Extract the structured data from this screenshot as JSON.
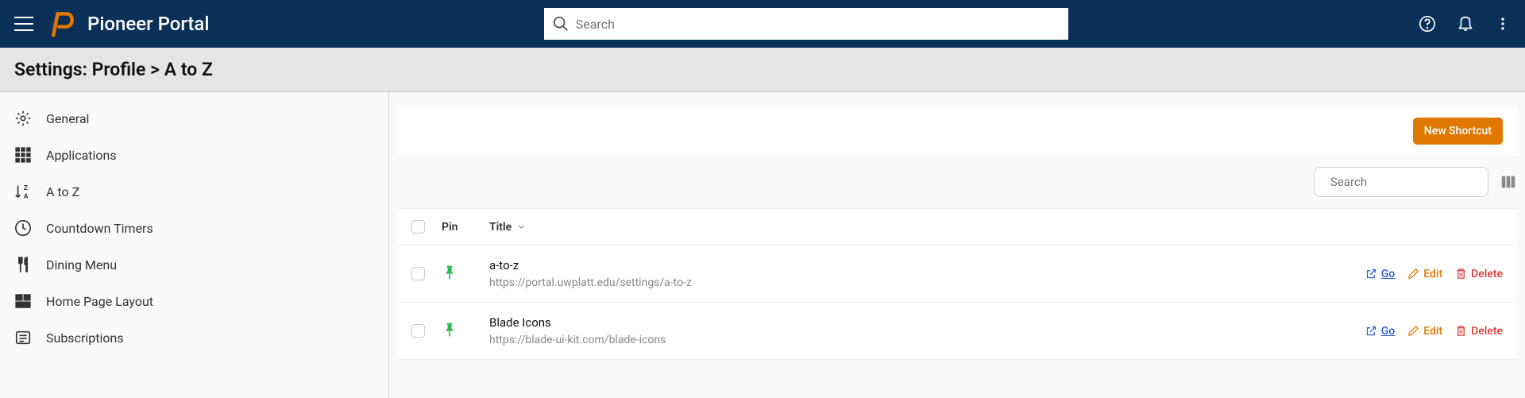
{
  "app": {
    "title": "Pioneer Portal",
    "search_placeholder": "Search"
  },
  "page": {
    "heading": "Settings: Profile > A to Z"
  },
  "sidebar": {
    "items": [
      {
        "label": "General",
        "icon": "gear"
      },
      {
        "label": "Applications",
        "icon": "grid"
      },
      {
        "label": "A to Z",
        "icon": "sort-az"
      },
      {
        "label": "Countdown Timers",
        "icon": "clock"
      },
      {
        "label": "Dining Menu",
        "icon": "utensils"
      },
      {
        "label": "Home Page Layout",
        "icon": "layout"
      },
      {
        "label": "Subscriptions",
        "icon": "newspaper"
      }
    ]
  },
  "main": {
    "new_button": "New Shortcut",
    "table_search_placeholder": "Search",
    "columns": {
      "pin": "Pin",
      "title": "Title"
    },
    "actions": {
      "go": "Go",
      "edit": "Edit",
      "delete": "Delete"
    },
    "rows": [
      {
        "title": "a-to-z",
        "url": "https://portal.uwplatt.edu/settings/a-to-z",
        "pinned": true
      },
      {
        "title": "Blade Icons",
        "url": "https://blade-ui-kit.com/blade-icons",
        "pinned": true
      }
    ]
  }
}
